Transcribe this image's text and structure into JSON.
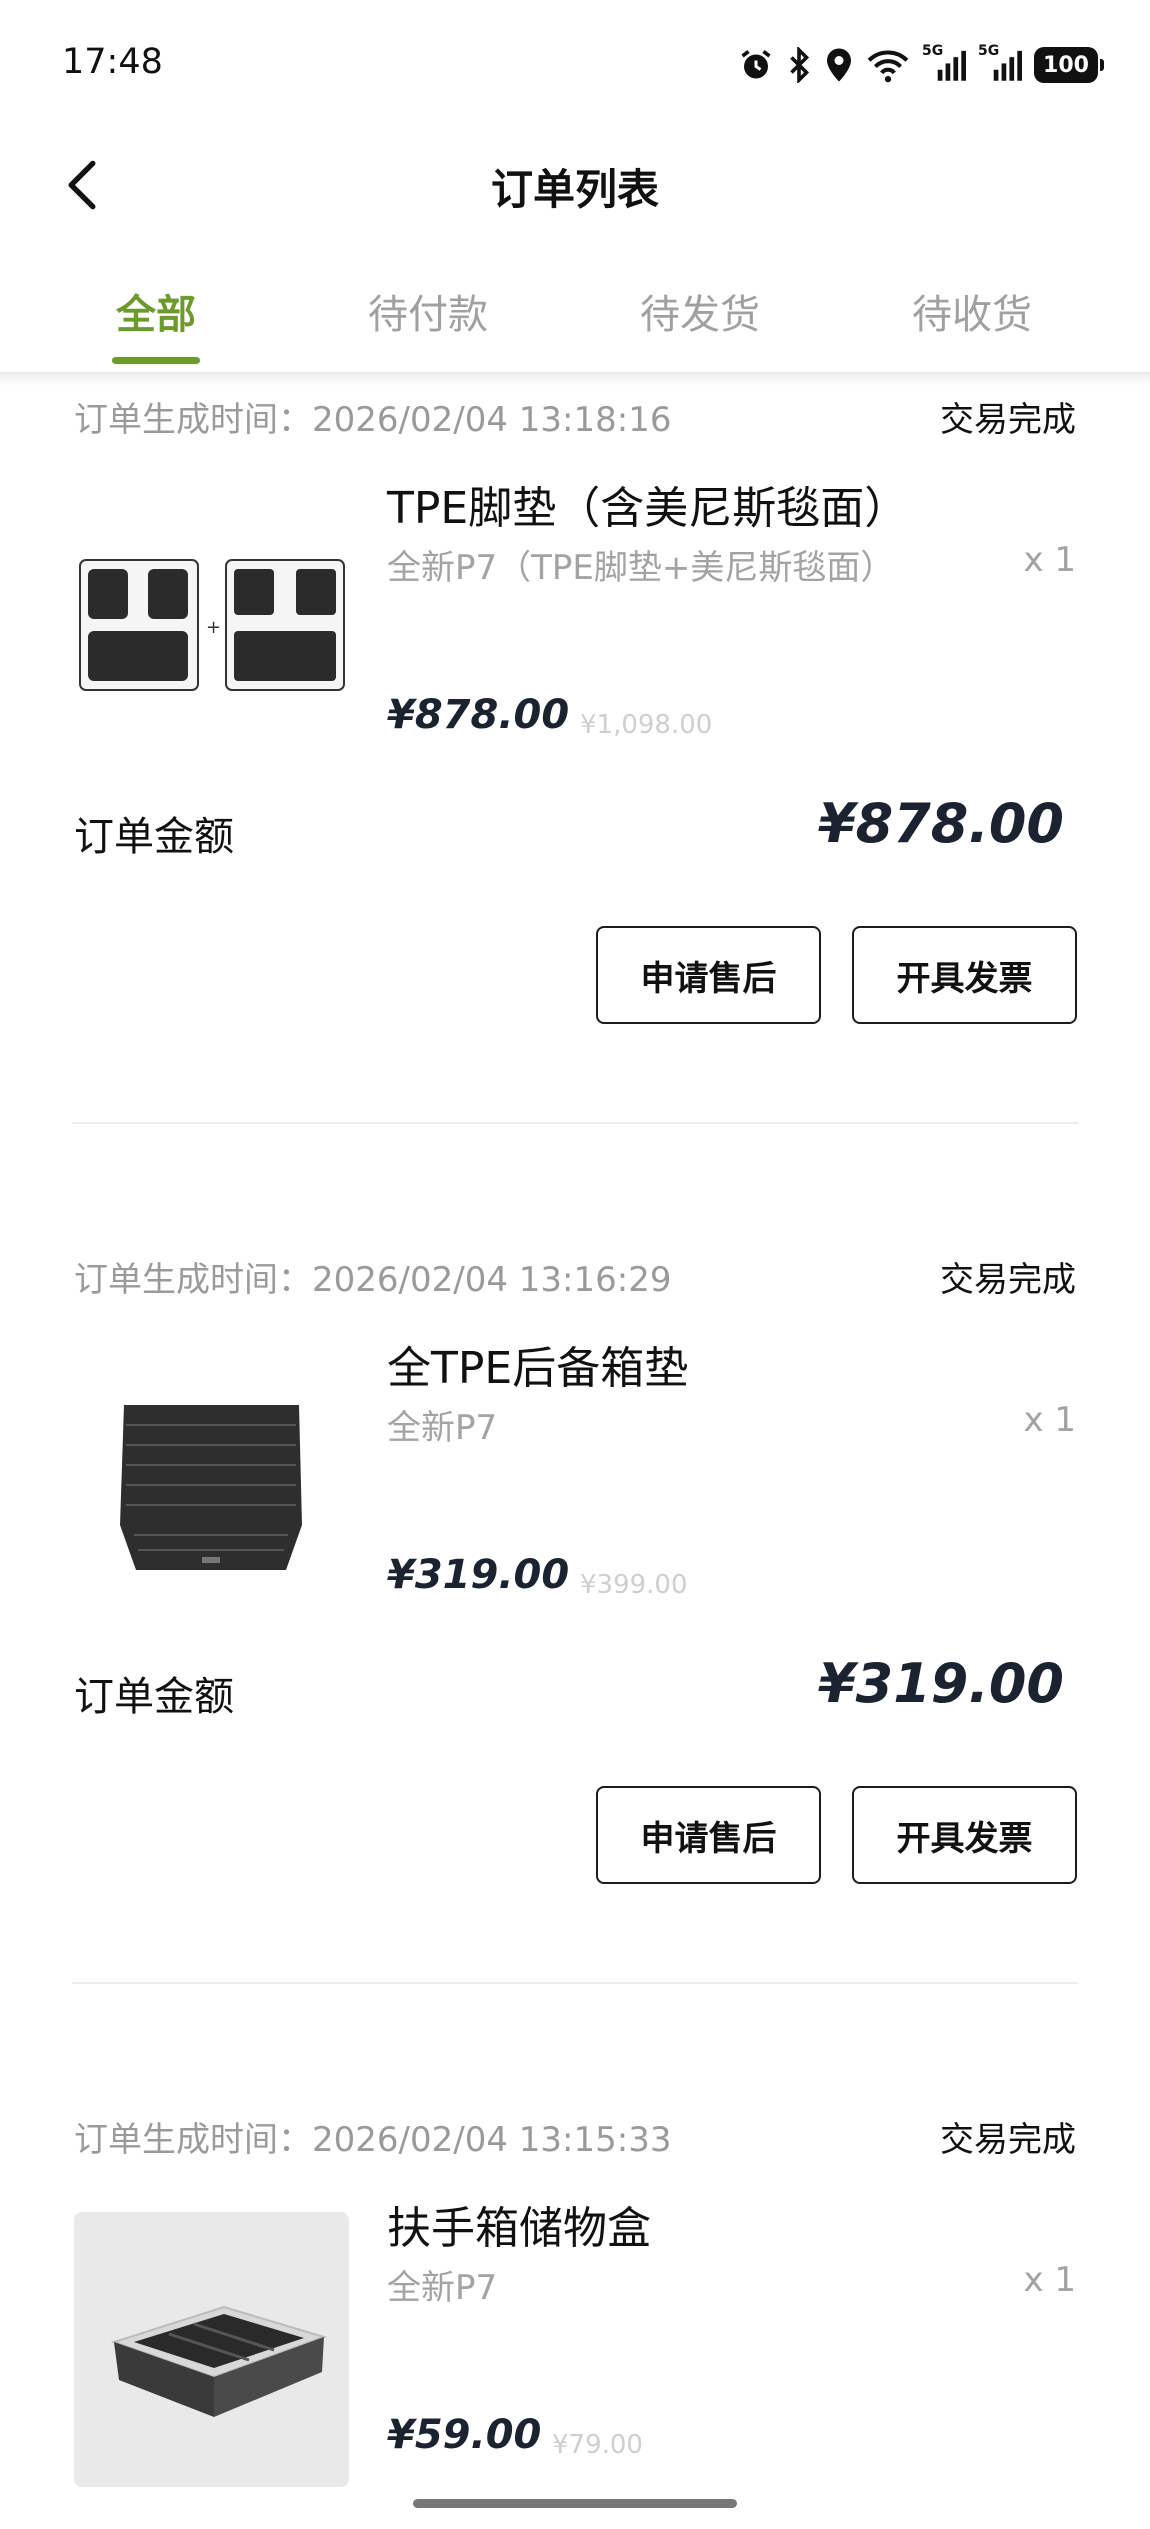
{
  "status_bar": {
    "time": "17:48",
    "battery": "100",
    "network_labels": [
      "5G",
      "5G"
    ]
  },
  "nav": {
    "title": "订单列表"
  },
  "tabs": [
    {
      "label": "全部",
      "active": true
    },
    {
      "label": "待付款",
      "active": false
    },
    {
      "label": "待发货",
      "active": false
    },
    {
      "label": "待收货",
      "active": false
    }
  ],
  "orders": [
    {
      "time": "订单生成时间：2026/02/04 13:18:16",
      "status": "交易完成",
      "product": {
        "image_icon": "floor-mat-set-image",
        "name": "TPE脚垫（含美尼斯毯面）",
        "variant": "全新P7（TPE脚垫+美尼斯毯面）",
        "qty": "x 1",
        "price": "¥878.00",
        "orig_price": "¥1,098.00"
      },
      "total_label": "订单金额",
      "total": "¥878.00",
      "buttons": {
        "after_sale": "申请售后",
        "invoice": "开具发票"
      }
    },
    {
      "time": "订单生成时间：2026/02/04 13:16:29",
      "status": "交易完成",
      "product": {
        "image_icon": "trunk-mat-image",
        "name": "全TPE后备箱垫",
        "variant": "全新P7",
        "qty": "x 1",
        "price": "¥319.00",
        "orig_price": "¥399.00"
      },
      "total_label": "订单金额",
      "total": "¥319.00",
      "buttons": {
        "after_sale": "申请售后",
        "invoice": "开具发票"
      }
    },
    {
      "time": "订单生成时间：2026/02/04 13:15:33",
      "status": "交易完成",
      "product": {
        "image_icon": "armrest-storage-box-image",
        "name": "扶手箱储物盒",
        "variant": "全新P7",
        "qty": "x 1",
        "price": "¥59.00",
        "orig_price": "¥79.00"
      }
    }
  ],
  "colors": {
    "accent": "#6d9a2c",
    "price": "#1c2330",
    "muted": "#9a9a9a"
  }
}
